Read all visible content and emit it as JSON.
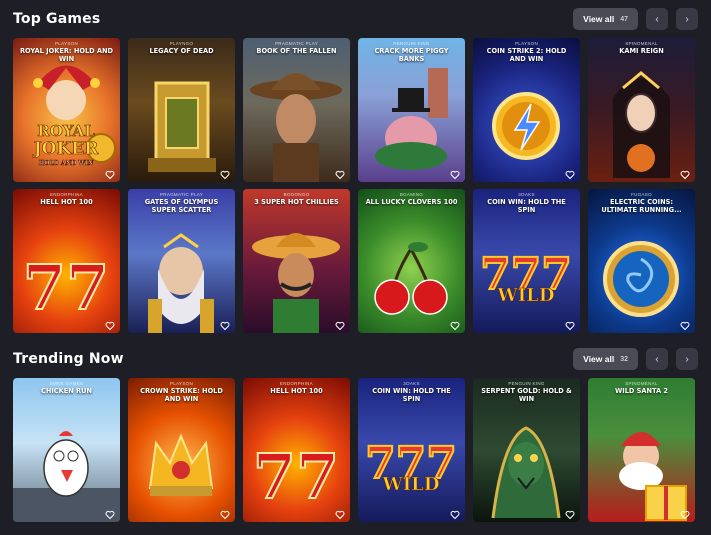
{
  "sections": [
    {
      "title": "Top Games",
      "view_all_label": "View all",
      "count": "47",
      "prev_icon": "chevron-left-icon",
      "next_icon": "chevron-right-icon",
      "games": [
        {
          "provider": "PLAYSON",
          "name": "ROYAL JOKER: HOLD AND WIN"
        },
        {
          "provider": "PLAYNGO",
          "name": "LEGACY OF DEAD"
        },
        {
          "provider": "PRAGMATIC PLAY",
          "name": "BOOK OF THE FALLEN"
        },
        {
          "provider": "PENGUIN KING",
          "name": "CRACK MORE PIGGY BANKS"
        },
        {
          "provider": "PLAYSON",
          "name": "COIN STRIKE 2: HOLD AND WIN"
        },
        {
          "provider": "SPINOMENAL",
          "name": "KAMI REIGN"
        },
        {
          "provider": "ENDORPHINA",
          "name": "HELL HOT 100"
        },
        {
          "provider": "PRAGMATIC PLAY",
          "name": "GATES OF OLYMPUS SUPER SCATTER"
        },
        {
          "provider": "BOOONGO",
          "name": "3 SUPER HOT CHILLIES"
        },
        {
          "provider": "BGAMING",
          "name": "ALL LUCKY CLOVERS 100"
        },
        {
          "provider": "3OAKS",
          "name": "COIN WIN: HOLD THE SPIN"
        },
        {
          "provider": "FUGASO",
          "name": "ELECTRIC COINS: ULTIMATE RUNNING..."
        }
      ]
    },
    {
      "title": "Trending Now",
      "view_all_label": "View all",
      "count": "32",
      "prev_icon": "chevron-left-icon",
      "next_icon": "chevron-right-icon",
      "games": [
        {
          "provider": "SMER GAMES",
          "name": "CHICKEN RUN"
        },
        {
          "provider": "PLAYSON",
          "name": "CROWN STRIKE: HOLD AND WIN"
        },
        {
          "provider": "ENDORPHINA",
          "name": "HELL HOT 100"
        },
        {
          "provider": "3OAKS",
          "name": "COIN WIN: HOLD THE SPIN"
        },
        {
          "provider": "PENGUIN KING",
          "name": "SERPENT GOLD: HOLD & WIN"
        },
        {
          "provider": "SPINOMENAL",
          "name": "WILD SANTA 2"
        }
      ]
    }
  ],
  "card_art_text": {
    "royal": "ROYAL",
    "joker": "JOKER",
    "hold": "HOLD AND WIN",
    "wild": "WILD"
  },
  "colors": {
    "background": "#1e1f26",
    "button": "#4a4b55",
    "nav_button": "#383944"
  }
}
